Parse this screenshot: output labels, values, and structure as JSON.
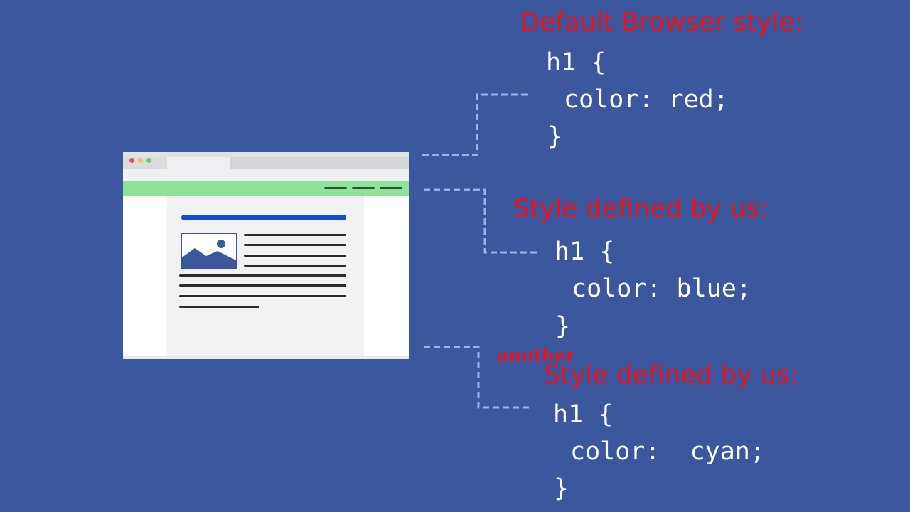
{
  "colors": {
    "background": "#3b579d",
    "label": "#e8131b",
    "code": "#ffffff",
    "connector": "#8db8e8",
    "navbar": "#8fe29b",
    "heading_bar": "#1a49d9"
  },
  "illustration": {
    "icons": [
      "browser-window",
      "image-placeholder-icon"
    ]
  },
  "blocks": [
    {
      "label": "Default Browser style:",
      "code": {
        "selector": "h1 {",
        "declaration": "color: red;",
        "close": "}"
      }
    },
    {
      "label": "Style defined by us:",
      "code": {
        "selector": "h1 {",
        "declaration": "color: blue;",
        "close": "}"
      }
    },
    {
      "prefix": "another",
      "label": "Style defined by us:",
      "code": {
        "selector": "h1 {",
        "declaration": "color:  cyan;",
        "close": "}"
      }
    }
  ]
}
